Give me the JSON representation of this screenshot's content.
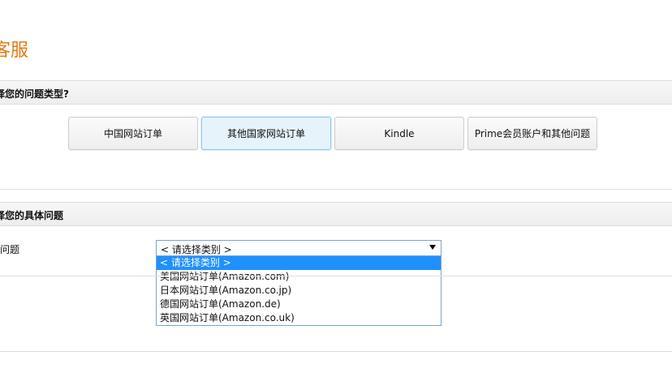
{
  "header": {
    "title": "客服"
  },
  "section1": {
    "header": "择您的问题类型?",
    "buttons": [
      {
        "label": "中国网站订单"
      },
      {
        "label": "其他国家网站订单"
      },
      {
        "label": "Kindle"
      },
      {
        "label": "Prime会员账户和其他问题"
      }
    ]
  },
  "section2": {
    "header": "择您的具体问题",
    "field_label": "问题",
    "select": {
      "value": "< 请选择类别 >",
      "options": [
        {
          "label": "< 请选择类别 >"
        },
        {
          "label": "美国网站订单(Amazon.com)"
        },
        {
          "label": "日本网站订单(Amazon.co.jp)"
        },
        {
          "label": "德国网站订单(Amazon.de)"
        },
        {
          "label": "英国网站订单(Amazon.co.uk)"
        }
      ]
    }
  },
  "colors": {
    "accent": "#e47911",
    "selected_bg": "#e6f3fb",
    "selected_border": "#8fc7e8",
    "highlight": "#1e90ff"
  }
}
